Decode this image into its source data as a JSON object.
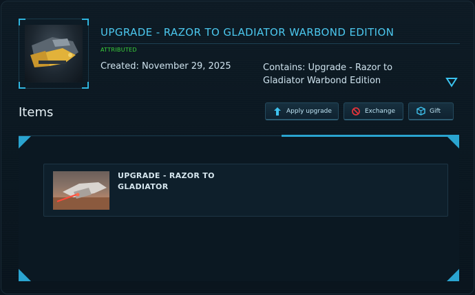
{
  "header": {
    "title": "UPGRADE - RAZOR TO GLADIATOR WARBOND EDITION",
    "badge": "ATTRIBUTED",
    "created": "Created: November 29, 2025",
    "contains": "Contains: Upgrade - Razor to Gladiator Warbond Edition",
    "expand_icon": "triangle-down-icon"
  },
  "items_section": {
    "heading": "Items",
    "buttons": [
      {
        "label": "Apply upgrade",
        "icon": "upgrade-arrow-icon"
      },
      {
        "label": "Exchange",
        "icon": "exchange-icon"
      },
      {
        "label": "Gift",
        "icon": "gift-box-icon"
      }
    ],
    "items": [
      {
        "name": "UPGRADE - RAZOR TO GLADIATOR"
      }
    ]
  },
  "colors": {
    "accent": "#4cc8ef",
    "badge": "#3bd43b",
    "corner": "#2aa4d0",
    "background": "#0b1620"
  }
}
